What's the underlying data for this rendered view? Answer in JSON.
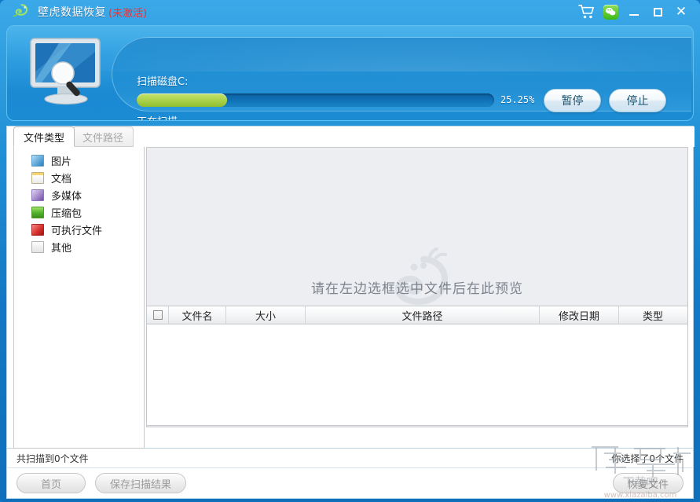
{
  "titlebar": {
    "app_name": "壁虎数据恢复",
    "activation_status": "(未激活)",
    "logo_icon": "gecko-logo",
    "cart_icon": "shopping-cart-icon",
    "wechat_icon": "wechat-icon",
    "minimize_label": "",
    "maximize_label": "",
    "close_label": "✕"
  },
  "scan": {
    "monitor_icon": "monitor-magnifier-icon",
    "disk_label": "扫描磁盘C:",
    "progress_percent_text": "25.25%",
    "progress_percent": 25.25,
    "scanning_label": "正在扫描...",
    "pause_button": "暂停",
    "stop_button": "停止",
    "track_color": "#0f6fb4",
    "fill_color": "#aed44f"
  },
  "tabs": [
    {
      "label": "文件类型",
      "active": true
    },
    {
      "label": "文件路径",
      "active": false
    }
  ],
  "tree": {
    "items": [
      {
        "label": "图片",
        "icon": "picture-icon"
      },
      {
        "label": "文档",
        "icon": "document-icon"
      },
      {
        "label": "多媒体",
        "icon": "multimedia-icon"
      },
      {
        "label": "压缩包",
        "icon": "archive-icon"
      },
      {
        "label": "可执行文件",
        "icon": "executable-icon"
      },
      {
        "label": "其他",
        "icon": "other-icon"
      }
    ]
  },
  "preview": {
    "placeholder": "请在左边选框选中文件后在此预览",
    "watermark_icon": "gecko-watermark"
  },
  "table": {
    "headers": {
      "select_all": "",
      "name": "文件名",
      "size": "大小",
      "path": "文件路径",
      "date": "修改日期",
      "type": "类型"
    },
    "rows": []
  },
  "statusbar": {
    "scanned_text": "共扫描到0个文件",
    "selected_text": "你选择了0个文件"
  },
  "bottombar": {
    "home_button": "首页",
    "save_button": "保存扫描结果",
    "recover_button": "恢复文件"
  },
  "watermark": {
    "site_name": "下载吧",
    "site_url": "www.xiazaiba.com"
  }
}
